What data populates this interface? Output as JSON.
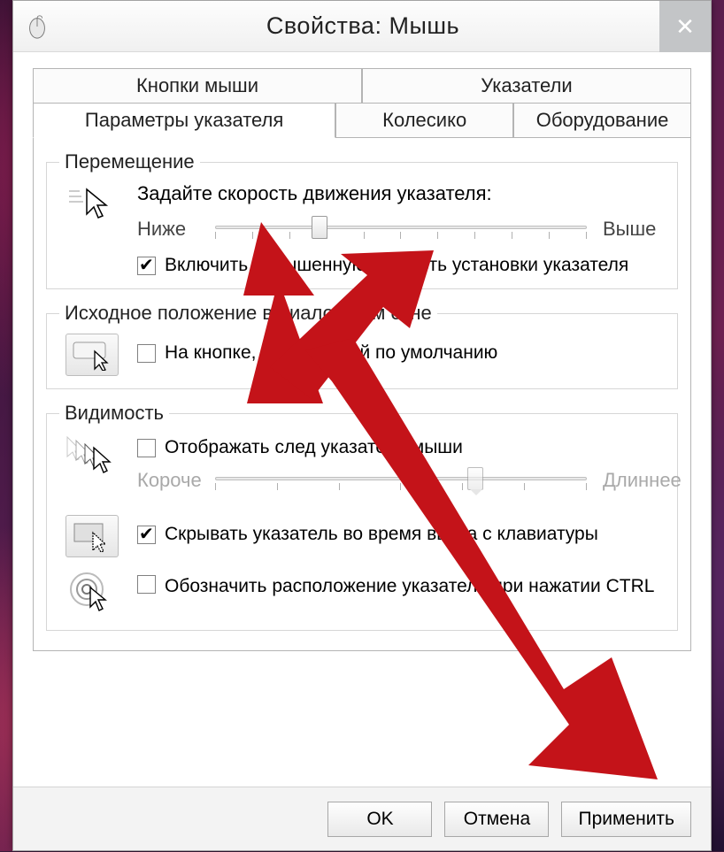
{
  "window": {
    "title": "Свойства: Мышь"
  },
  "tabs": {
    "buttons": "Кнопки мыши",
    "pointers": "Указатели",
    "params": "Параметры указателя",
    "wheel": "Колесико",
    "hardware": "Оборудование"
  },
  "groups": {
    "motion": {
      "legend": "Перемещение",
      "speed_label": "Задайте скорость движения указателя:",
      "slow": "Ниже",
      "fast": "Выше",
      "precision_label": "Включить повышенную точность установки указателя",
      "precision_checked": true,
      "slider_percent": 28
    },
    "snap": {
      "legend": "Исходное положение в диалоговом окне",
      "label": "На кнопке, выбираемой по умолчанию",
      "checked": false
    },
    "visibility": {
      "legend": "Видимость",
      "trails_label": "Отображать след указателя мыши",
      "trails_checked": false,
      "trail_short": "Короче",
      "trail_long": "Длиннее",
      "trail_slider_percent": 70,
      "trail_disabled": true,
      "hide_typing_label": "Скрывать указатель во время ввода с клавиатуры",
      "hide_typing_checked": true,
      "ctrl_locate_label": "Обозначить расположение указателя при нажатии CTRL",
      "ctrl_locate_checked": false
    }
  },
  "buttons": {
    "ok": "OK",
    "cancel": "Отмена",
    "apply": "Применить"
  }
}
